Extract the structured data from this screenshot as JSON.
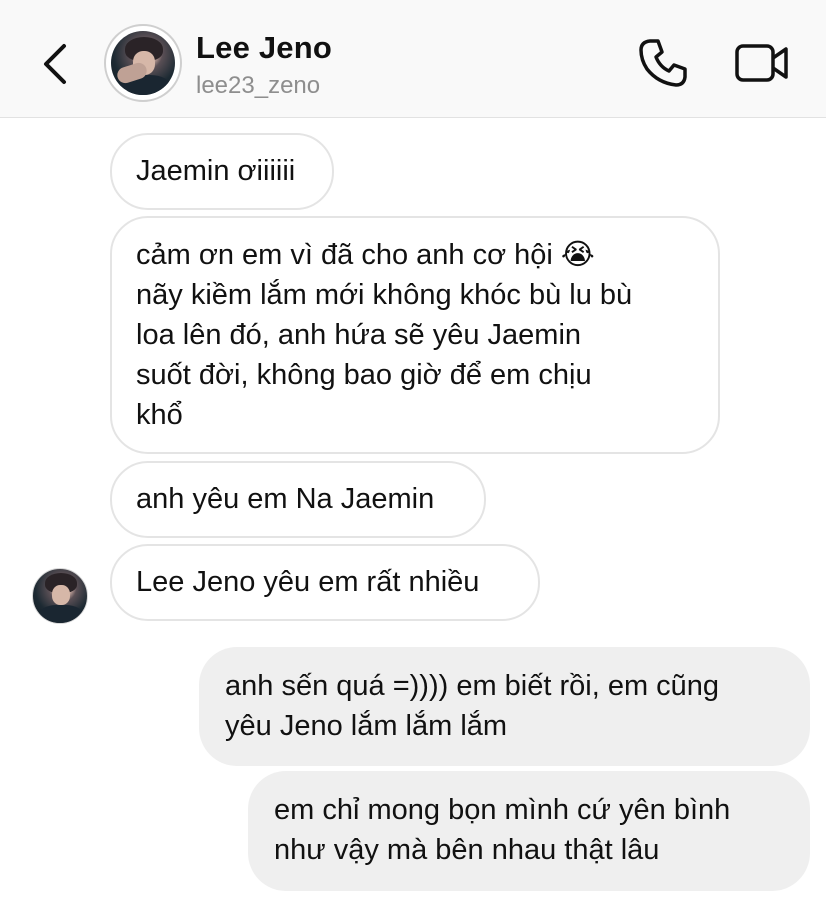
{
  "header": {
    "name": "Lee Jeno",
    "handle": "lee23_zeno"
  },
  "icons": {
    "back": "chevron-left-icon",
    "call": "phone-icon",
    "video": "video-camera-icon",
    "emoji": "loudly-crying-face"
  },
  "messages": {
    "m1": "Jaemin ơiiiiii",
    "m2_line1": "cảm ơn em vì đã cho anh cơ hội 😭",
    "m2_rest": "nãy kiềm lắm mới không khóc bù lu bù\nloa lên đó, anh hứa sẽ yêu Jaemin\nsuốt đời, không bao giờ để em chịu\nkhổ",
    "m3": "anh yêu em Na Jaemin",
    "m4": "Lee Jeno yêu em rất nhiều",
    "m5": "anh sến quá =)))) em biết rồi, em cũng\nyêu Jeno lắm lắm lắm",
    "m6": "em chỉ mong bọn mình cứ yên bình\nnhư vậy mà bên nhau thật lâu"
  },
  "colors": {
    "incoming_bubble": "#ffffff",
    "outgoing_bubble": "#efefef",
    "header_bg": "#f9f9f9"
  }
}
